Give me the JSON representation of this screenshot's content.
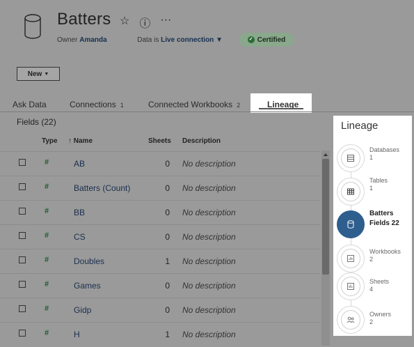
{
  "header": {
    "title": "Batters",
    "owner_label": "Owner",
    "owner_name": "Amanda",
    "data_is_label": "Data is",
    "connection": "Live connection",
    "certified": "Certified"
  },
  "toolbar": {
    "new_label": "New"
  },
  "tabs": [
    {
      "label": "Ask Data",
      "count": ""
    },
    {
      "label": "Connections",
      "count": "1"
    },
    {
      "label": "Connected Workbooks",
      "count": "2"
    },
    {
      "label": "Lineage",
      "count": ""
    }
  ],
  "fields_label": "Fields (22)",
  "table": {
    "headers": {
      "type": "Type",
      "name": "↑ Name",
      "sheets": "Sheets",
      "description": "Description"
    },
    "rows": [
      {
        "type": "#",
        "name": "AB",
        "sheets": "0",
        "description": "No description"
      },
      {
        "type": "#",
        "name": "Batters (Count)",
        "sheets": "0",
        "description": "No description"
      },
      {
        "type": "#",
        "name": "BB",
        "sheets": "0",
        "description": "No description"
      },
      {
        "type": "#",
        "name": "CS",
        "sheets": "0",
        "description": "No description"
      },
      {
        "type": "#",
        "name": "Doubles",
        "sheets": "1",
        "description": "No description"
      },
      {
        "type": "#",
        "name": "Games",
        "sheets": "0",
        "description": "No description"
      },
      {
        "type": "#",
        "name": "Gidp",
        "sheets": "0",
        "description": "No description"
      },
      {
        "type": "#",
        "name": "H",
        "sheets": "1",
        "description": "No description"
      }
    ]
  },
  "lineage": {
    "title": "Lineage",
    "nodes": [
      {
        "label": "Databases",
        "count": "1",
        "icon": "database-icon"
      },
      {
        "label": "Tables",
        "count": "1",
        "icon": "table-icon"
      },
      {
        "label": "Batters",
        "count": "Fields 22",
        "icon": "datasource-icon"
      },
      {
        "label": "Workbooks",
        "count": "2",
        "icon": "workbook-icon"
      },
      {
        "label": "Sheets",
        "count": "4",
        "icon": "sheet-icon"
      },
      {
        "label": "Owners",
        "count": "2",
        "icon": "owners-icon"
      }
    ]
  },
  "colors": {
    "accent": "#2d5e8e",
    "certified": "#2c6b35",
    "link": "#1a2f4e"
  }
}
